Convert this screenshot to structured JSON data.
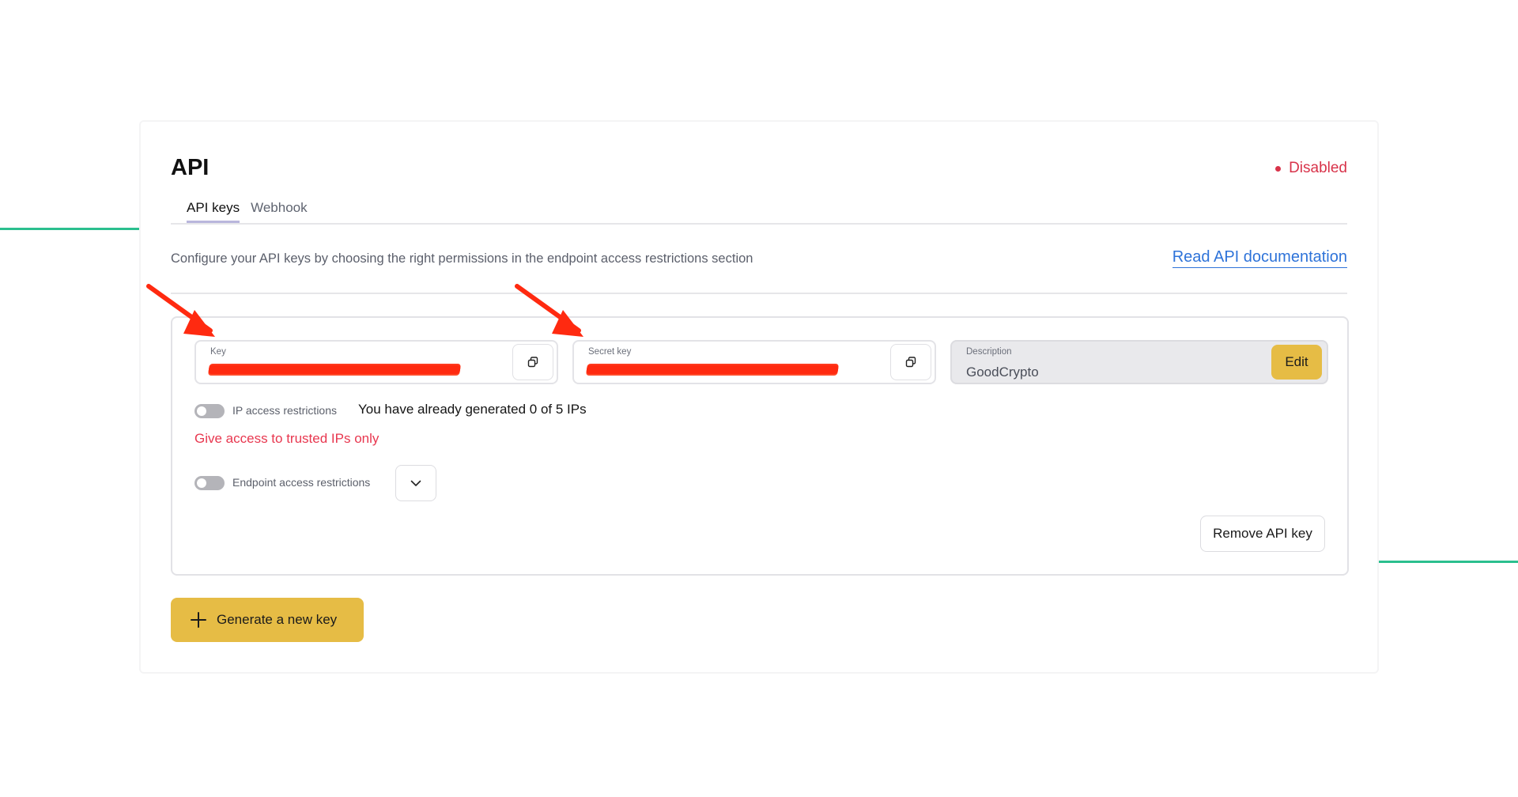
{
  "page": {
    "title": "API",
    "status": {
      "text": "Disabled",
      "color": "#d8334a"
    },
    "tabs": [
      {
        "label": "API keys",
        "active": true
      },
      {
        "label": "Webhook",
        "active": false
      }
    ],
    "intro_text": "Configure your API keys by choosing the right permissions in the endpoint access restrictions section",
    "docs_link": "Read API documentation"
  },
  "key_card": {
    "key_field": {
      "label": "Key",
      "value_redacted": true,
      "copy_icon": "copy-icon"
    },
    "secret_field": {
      "label": "Secret key",
      "value_redacted": true,
      "copy_icon": "copy-icon"
    },
    "description_field": {
      "label": "Description",
      "value": "GoodCrypto",
      "edit_label": "Edit"
    },
    "ip_restrictions": {
      "label": "IP access restrictions",
      "enabled": false,
      "count_text": "You have already generated 0 of 5 IPs",
      "warning": "Give access to trusted IPs only"
    },
    "endpoint_restrictions": {
      "label": "Endpoint access restrictions",
      "enabled": false,
      "dropdown_icon": "chevron-down-icon"
    },
    "remove_label": "Remove API key"
  },
  "generate": {
    "label": "Generate a new key",
    "icon": "plus-icon"
  },
  "colors": {
    "accent_yellow": "#e6bc45",
    "link_blue": "#2e73d9",
    "warning_red": "#e8374f",
    "annotation_red": "#ff2a10",
    "decor_green": "#2bbf8e"
  }
}
